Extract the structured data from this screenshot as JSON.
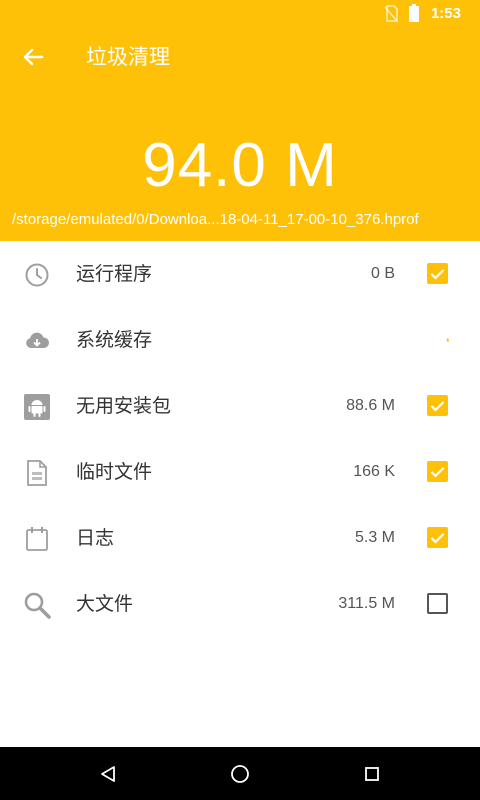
{
  "status_bar": {
    "time": "1:53",
    "icons": [
      "no-sim-icon",
      "battery-icon"
    ]
  },
  "toolbar": {
    "back_icon": "arrow-left-icon",
    "title": "垃圾清理"
  },
  "summary": {
    "total_size": "94.0 M",
    "current_path": "/storage/emulated/0/Downloa...18-04-11_17-00-10_376.hprof"
  },
  "items": [
    {
      "icon": "clock-icon",
      "label": "运行程序",
      "size": "0 B",
      "state": "checked"
    },
    {
      "icon": "cloud-download-icon",
      "label": "系统缓存",
      "size": "",
      "state": "scanning"
    },
    {
      "icon": "android-icon",
      "label": "无用安装包",
      "size": "88.6 M",
      "state": "checked"
    },
    {
      "icon": "temp-file-icon",
      "label": "临时文件",
      "size": "166 K",
      "state": "checked"
    },
    {
      "icon": "log-icon",
      "label": "日志",
      "size": "5.3 M",
      "state": "checked"
    },
    {
      "icon": "search-icon",
      "label": "大文件",
      "size": "311.5 M",
      "state": "unchecked"
    }
  ],
  "colors": {
    "accent": "#FFC107",
    "text": "#333333",
    "icon": "#9E9E9E"
  },
  "nav_bar": {
    "buttons": [
      "back-triangle-icon",
      "home-circle-icon",
      "recents-square-icon"
    ]
  }
}
